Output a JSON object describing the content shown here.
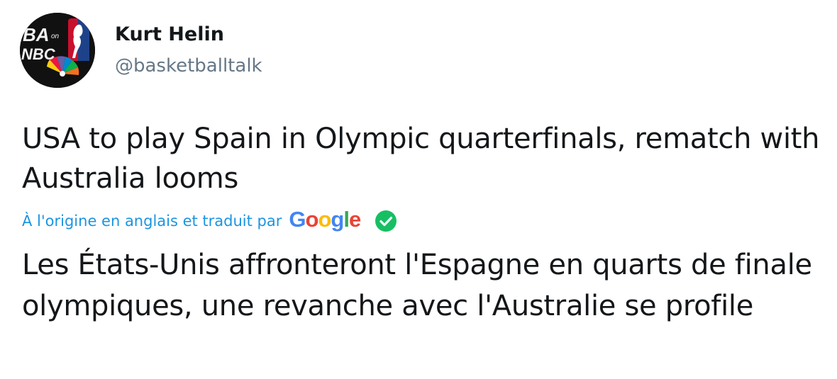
{
  "author": {
    "name": "Kurt Helin",
    "handle": "@basketballtalk",
    "avatar_icon": "nba-on-nbc-logo-icon",
    "avatar_text_top": "BA",
    "avatar_text_on": "on",
    "avatar_text_bottom": "NBC"
  },
  "tweet": {
    "text": "USA to play Spain in Olympic quarterfinals, rematch with Australia looms"
  },
  "translation": {
    "note": "À l'origine en anglais et traduit par",
    "provider": "Google",
    "provider_letters": [
      "G",
      "o",
      "o",
      "g",
      "l",
      "e"
    ],
    "provider_colors": [
      "#4285f4",
      "#ea4335",
      "#fbbc05",
      "#4285f4",
      "#34a853",
      "#ea4335"
    ],
    "status_icon": "checkmark-circle-icon",
    "status_color": "#17bf63",
    "translated_text": "Les États-Unis affronteront l'Espagne en quarts de finale olympiques, une revanche avec l'Australie se profile"
  },
  "colors": {
    "text_primary": "#14171a",
    "text_secondary": "#657786",
    "link_blue": "#1b95e0"
  }
}
